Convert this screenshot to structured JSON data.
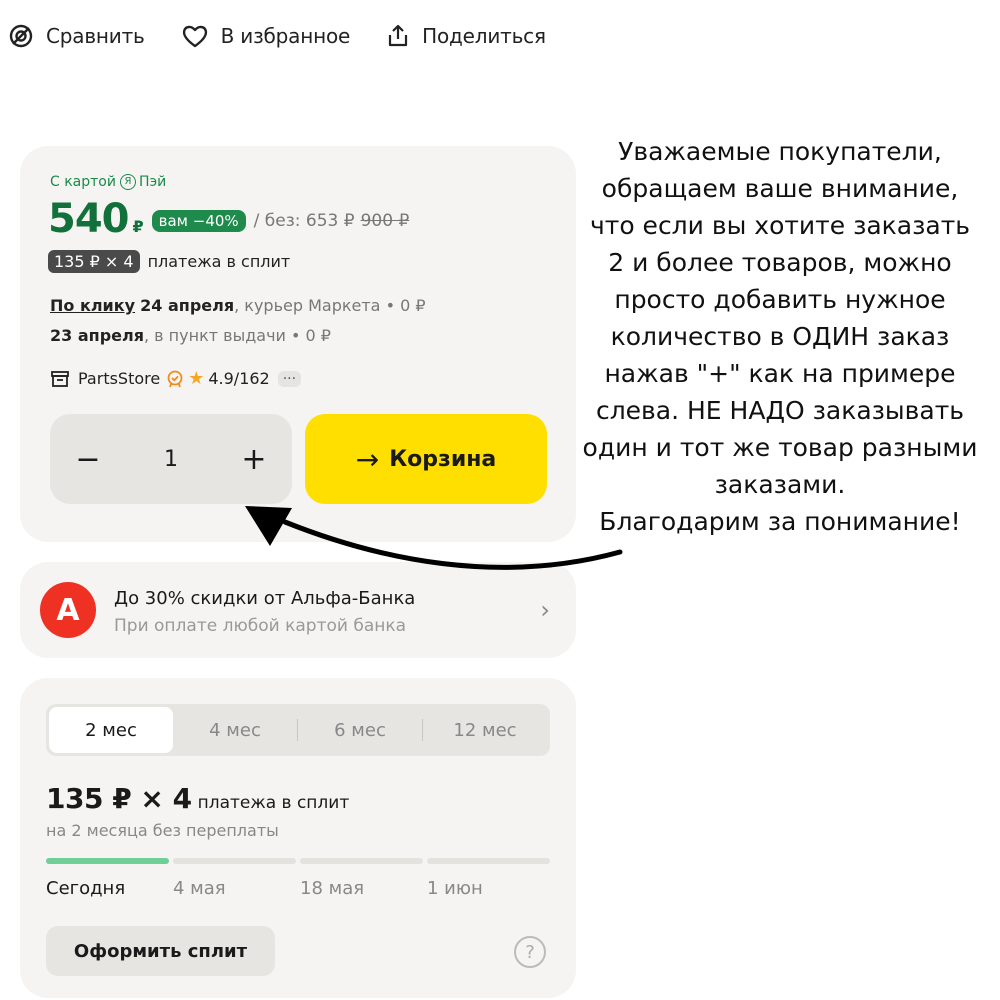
{
  "topbar": {
    "compare_label": "Сравнить",
    "favorite_label": "В избранное",
    "share_label": "Поделиться"
  },
  "offer": {
    "pay_label_prefix": "С картой",
    "pay_badge_glyph": "Я",
    "pay_label_suffix": "Пэй",
    "price": "540",
    "currency": "₽",
    "discount_badge": "вам −40%",
    "price_without_label": "/ без: 653 ₽",
    "price_old": "900 ₽",
    "split_chip": "135 ₽ × 4",
    "split_text": "платежа в сплит",
    "delivery_courier_link": "По клику",
    "delivery_courier_date": "24 апреля",
    "delivery_courier_rest": ", курьер Маркета • 0 ₽",
    "delivery_pickup_date": "23 апреля",
    "delivery_pickup_rest": ", в пункт выдачи • 0 ₽",
    "seller_name": "PartsStore",
    "seller_rating": "4.9/162",
    "more_label": "···",
    "quantity": "1",
    "minus_label": "−",
    "plus_label": "+",
    "cart_label": "Корзина",
    "cart_arrow": "→",
    "accent_yellow": "#ffdf00",
    "price_green": "#12703a"
  },
  "bank_promo": {
    "logo_letter": "А",
    "title": "До 30% скидки от Альфа-Банка",
    "subtitle": "При оплате любой картой банка",
    "chevron": "›",
    "brand_color": "#ef3124"
  },
  "split": {
    "tabs": [
      {
        "label": "2 мес",
        "active": true
      },
      {
        "label": "4 мес",
        "active": false
      },
      {
        "label": "6 мес",
        "active": false
      },
      {
        "label": "12 мес",
        "active": false
      }
    ],
    "amount": "135 ₽ × 4",
    "amount_suffix": "платежа в сплит",
    "subtitle": "на 2 месяца без переплаты",
    "schedule": [
      {
        "date": "Сегодня",
        "done": true
      },
      {
        "date": "4 мая",
        "done": false
      },
      {
        "date": "18 мая",
        "done": false
      },
      {
        "date": "1 июн",
        "done": false
      }
    ],
    "checkout_label": "Оформить сплит",
    "help_glyph": "?"
  },
  "notice": {
    "text": "Уважаемые покупатели,\nобращаем ваше внимание,\nчто если вы хотите заказать\n2 и более товаров, можно\nпросто добавить нужное\nколичество в ОДИН заказ\nнажав \"+\" как на примере\nслева. НЕ НАДО заказывать\nодин и тот же товар разными\nзаказами.\nБлагодарим за понимание!"
  }
}
